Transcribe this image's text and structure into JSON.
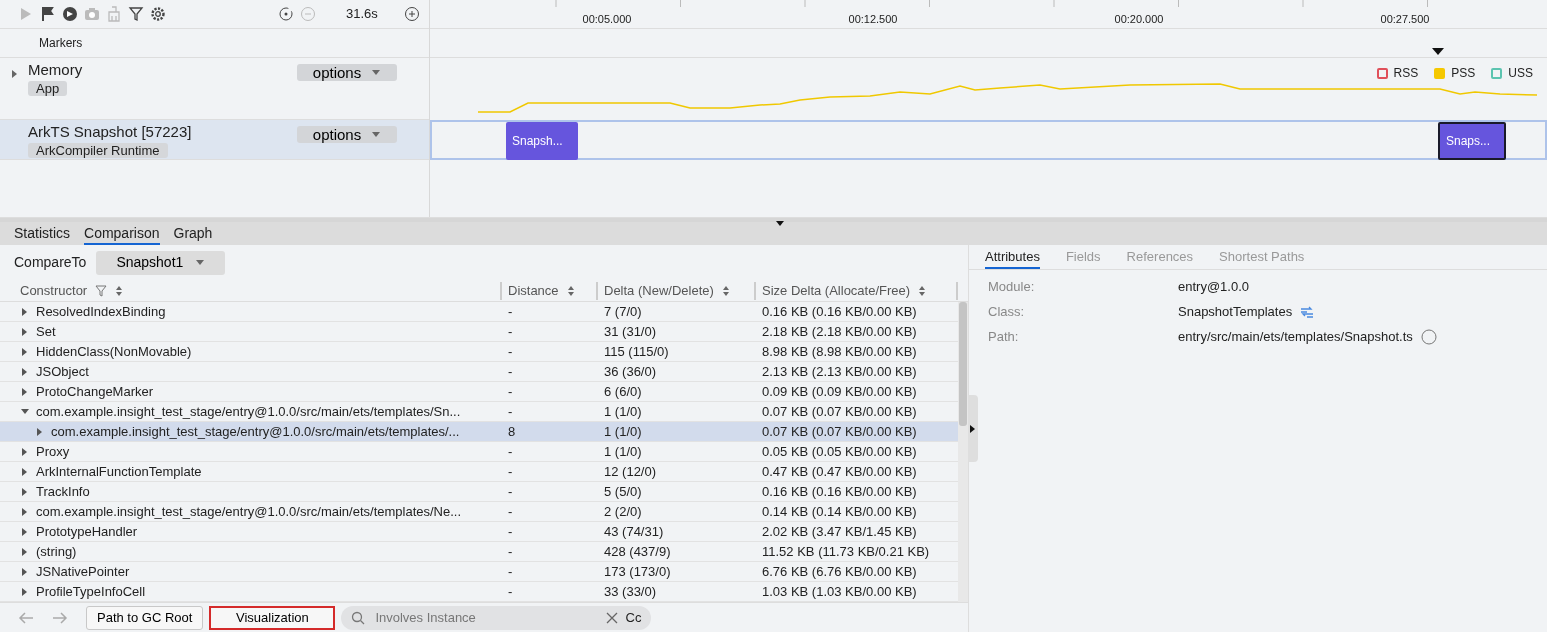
{
  "toolbar": {
    "tools": [
      {
        "disabled": true
      },
      {
        "disabled": false
      },
      {
        "disabled": false
      },
      {
        "disabled": true
      },
      {
        "disabled": true
      },
      {
        "disabled": false
      },
      {
        "disabled": false
      }
    ],
    "zoom_tools": [
      {
        "disabled": false
      },
      {
        "disabled": true
      },
      {
        "disabled": false
      }
    ],
    "duration": "31.6s"
  },
  "markers_label": "Markers",
  "tracks": [
    {
      "name": "Memory",
      "tag": "App",
      "options": "options",
      "expandable": true,
      "selected": false
    },
    {
      "name": "ArkTS Snapshot [57223]",
      "tag": "ArkCompiler Runtime",
      "options": "options",
      "expandable": false,
      "selected": true
    }
  ],
  "timeline": {
    "ticks": [
      "00:05.000",
      "00:12.500",
      "00:20.000",
      "00:27.500"
    ],
    "legend": [
      {
        "label": "RSS",
        "color": "#e0505a",
        "on": false
      },
      {
        "label": "PSS",
        "color": "#f5c800",
        "on": true
      },
      {
        "label": "USS",
        "color": "#5cc4b0",
        "on": false
      }
    ],
    "snapshots": [
      {
        "label": "Snapsh...",
        "selected": false
      },
      {
        "label": "Snaps...",
        "selected": true
      }
    ]
  },
  "detail_tabs": [
    {
      "label": "Statistics",
      "selected": false
    },
    {
      "label": "Comparison",
      "selected": true
    },
    {
      "label": "Graph",
      "selected": false
    }
  ],
  "compare": {
    "label": "CompareTo",
    "value": "Snapshot1"
  },
  "table": {
    "columns": [
      "Constructor",
      "Distance",
      "Delta (New/Delete)",
      "Size Delta (Allocate/Free)"
    ],
    "rows": [
      {
        "cells": [
          "ResolvedIndexBinding",
          "-",
          "7 (7/0)",
          "0.16 KB (0.16 KB/0.00 KB)"
        ],
        "expanded": false,
        "selected": false
      },
      {
        "cells": [
          "Set",
          "-",
          "31 (31/0)",
          "2.18 KB (2.18 KB/0.00 KB)"
        ],
        "expanded": false,
        "selected": false
      },
      {
        "cells": [
          "HiddenClass(NonMovable)",
          "-",
          "115 (115/0)",
          "8.98 KB (8.98 KB/0.00 KB)"
        ],
        "expanded": false,
        "selected": false
      },
      {
        "cells": [
          "JSObject",
          "-",
          "36 (36/0)",
          "2.13 KB (2.13 KB/0.00 KB)"
        ],
        "expanded": false,
        "selected": false
      },
      {
        "cells": [
          "ProtoChangeMarker",
          "-",
          "6 (6/0)",
          "0.09 KB (0.09 KB/0.00 KB)"
        ],
        "expanded": false,
        "selected": false
      },
      {
        "cells": [
          "com.example.insight_test_stage/entry@1.0.0/src/main/ets/templates/Sn...",
          "-",
          "1 (1/0)",
          "0.07 KB (0.07 KB/0.00 KB)"
        ],
        "expanded": true,
        "selected": false,
        "children": [
          {
            "cells": [
              "com.example.insight_test_stage/entry@1.0.0/src/main/ets/templates/...",
              "8",
              "1 (1/0)",
              "0.07 KB (0.07 KB/0.00 KB)"
            ],
            "expanded": false,
            "selected": true
          }
        ]
      },
      {
        "cells": [
          "Proxy",
          "-",
          "1 (1/0)",
          "0.05 KB (0.05 KB/0.00 KB)"
        ],
        "expanded": false,
        "selected": false
      },
      {
        "cells": [
          "ArkInternalFunctionTemplate",
          "-",
          "12 (12/0)",
          "0.47 KB (0.47 KB/0.00 KB)"
        ],
        "expanded": false,
        "selected": false
      },
      {
        "cells": [
          "TrackInfo",
          "-",
          "5 (5/0)",
          "0.16 KB (0.16 KB/0.00 KB)"
        ],
        "expanded": false,
        "selected": false
      },
      {
        "cells": [
          "com.example.insight_test_stage/entry@1.0.0/src/main/ets/templates/Ne...",
          "-",
          "2 (2/0)",
          "0.14 KB (0.14 KB/0.00 KB)"
        ],
        "expanded": false,
        "selected": false
      },
      {
        "cells": [
          "PrototypeHandler",
          "-",
          "43 (74/31)",
          "2.02 KB (3.47 KB/1.45 KB)"
        ],
        "expanded": false,
        "selected": false
      },
      {
        "cells": [
          "(string)",
          "-",
          "428 (437/9)",
          "11.52 KB (11.73 KB/0.21 KB)"
        ],
        "expanded": false,
        "selected": false
      },
      {
        "cells": [
          "JSNativePointer",
          "-",
          "173 (173/0)",
          "6.76 KB (6.76 KB/0.00 KB)"
        ],
        "expanded": false,
        "selected": false
      },
      {
        "cells": [
          "ProfileTypeInfoCell",
          "-",
          "33 (33/0)",
          "1.03 KB (1.03 KB/0.00 KB)"
        ],
        "expanded": false,
        "selected": false
      }
    ]
  },
  "footer": {
    "back_disabled": true,
    "forward_disabled": true,
    "buttons": [
      {
        "label": "Path to GC Root",
        "highlighted": false
      },
      {
        "label": "Visualization",
        "highlighted": true
      }
    ],
    "search": {
      "placeholder": "Involves Instance",
      "case_toggle": "Cc"
    }
  },
  "inspector": {
    "tabs": [
      {
        "label": "Attributes",
        "selected": true
      },
      {
        "label": "Fields",
        "selected": false
      },
      {
        "label": "References",
        "selected": false
      },
      {
        "label": "Shortest Paths",
        "selected": false
      }
    ],
    "attributes": [
      {
        "label": "Module:",
        "value": "entry@1.0.0"
      },
      {
        "label": "Class:",
        "value": "SnapshotTemplates",
        "kind": "link"
      },
      {
        "label": "Path:",
        "value": "entry/src/main/ets/templates/Snapshot.ts",
        "kind": "help"
      }
    ]
  }
}
